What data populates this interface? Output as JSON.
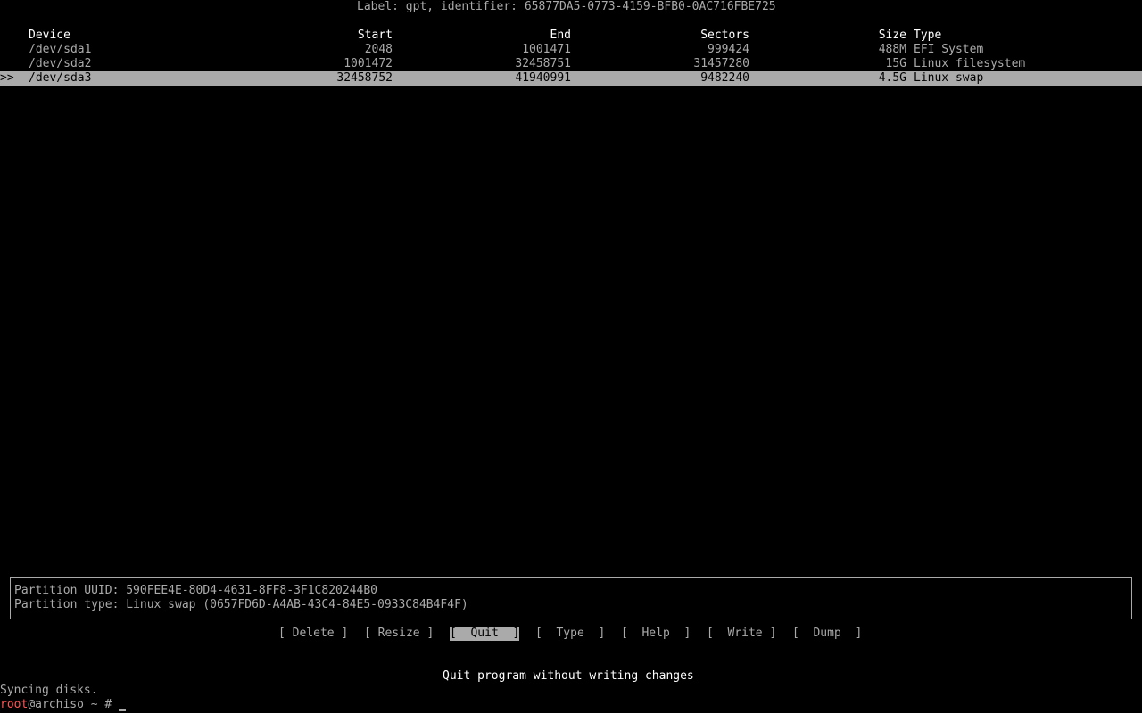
{
  "header": {
    "label": "Label: gpt, identifier: 65877DA5-0773-4159-BFB0-0AC716FBE725"
  },
  "table": {
    "columns": {
      "device": "Device",
      "start": "Start",
      "end": "End",
      "sectors": "Sectors",
      "size": "Size",
      "type": "Type"
    },
    "selection_marker": ">>",
    "rows": [
      {
        "device": "/dev/sda1",
        "start": "2048",
        "end": "1001471",
        "sectors": "999424",
        "size": "488M",
        "type": "EFI System"
      },
      {
        "device": "/dev/sda2",
        "start": "1001472",
        "end": "32458751",
        "sectors": "31457280",
        "size": "15G",
        "type": "Linux filesystem"
      },
      {
        "device": "/dev/sda3",
        "start": "32458752",
        "end": "41940991",
        "sectors": "9482240",
        "size": "4.5G",
        "type": "Linux swap"
      }
    ]
  },
  "info": {
    "uuid_line": "Partition UUID: 590FEE4E-80D4-4631-8FF8-3F1C820244B0",
    "type_line": "Partition type: Linux swap (0657FD6D-A4AB-43C4-84E5-0933C84B4F4F)"
  },
  "menu": {
    "delete": "[ Delete ]",
    "resize": "[ Resize ]",
    "quit": "[  Quit  ]",
    "type": "[  Type  ]",
    "help": "[  Help  ]",
    "write": "[  Write ]",
    "dump": "[  Dump  ]"
  },
  "hint": "Quit program without writing changes",
  "terminal": {
    "syncing": "Syncing disks.",
    "prompt_user": "root",
    "prompt_rest": "@archiso ~ # "
  },
  "colors": {
    "background": "#000000",
    "text": "#aaaaaa",
    "highlight_bg": "#aaaaaa",
    "prompt_user": "#ff5555"
  }
}
